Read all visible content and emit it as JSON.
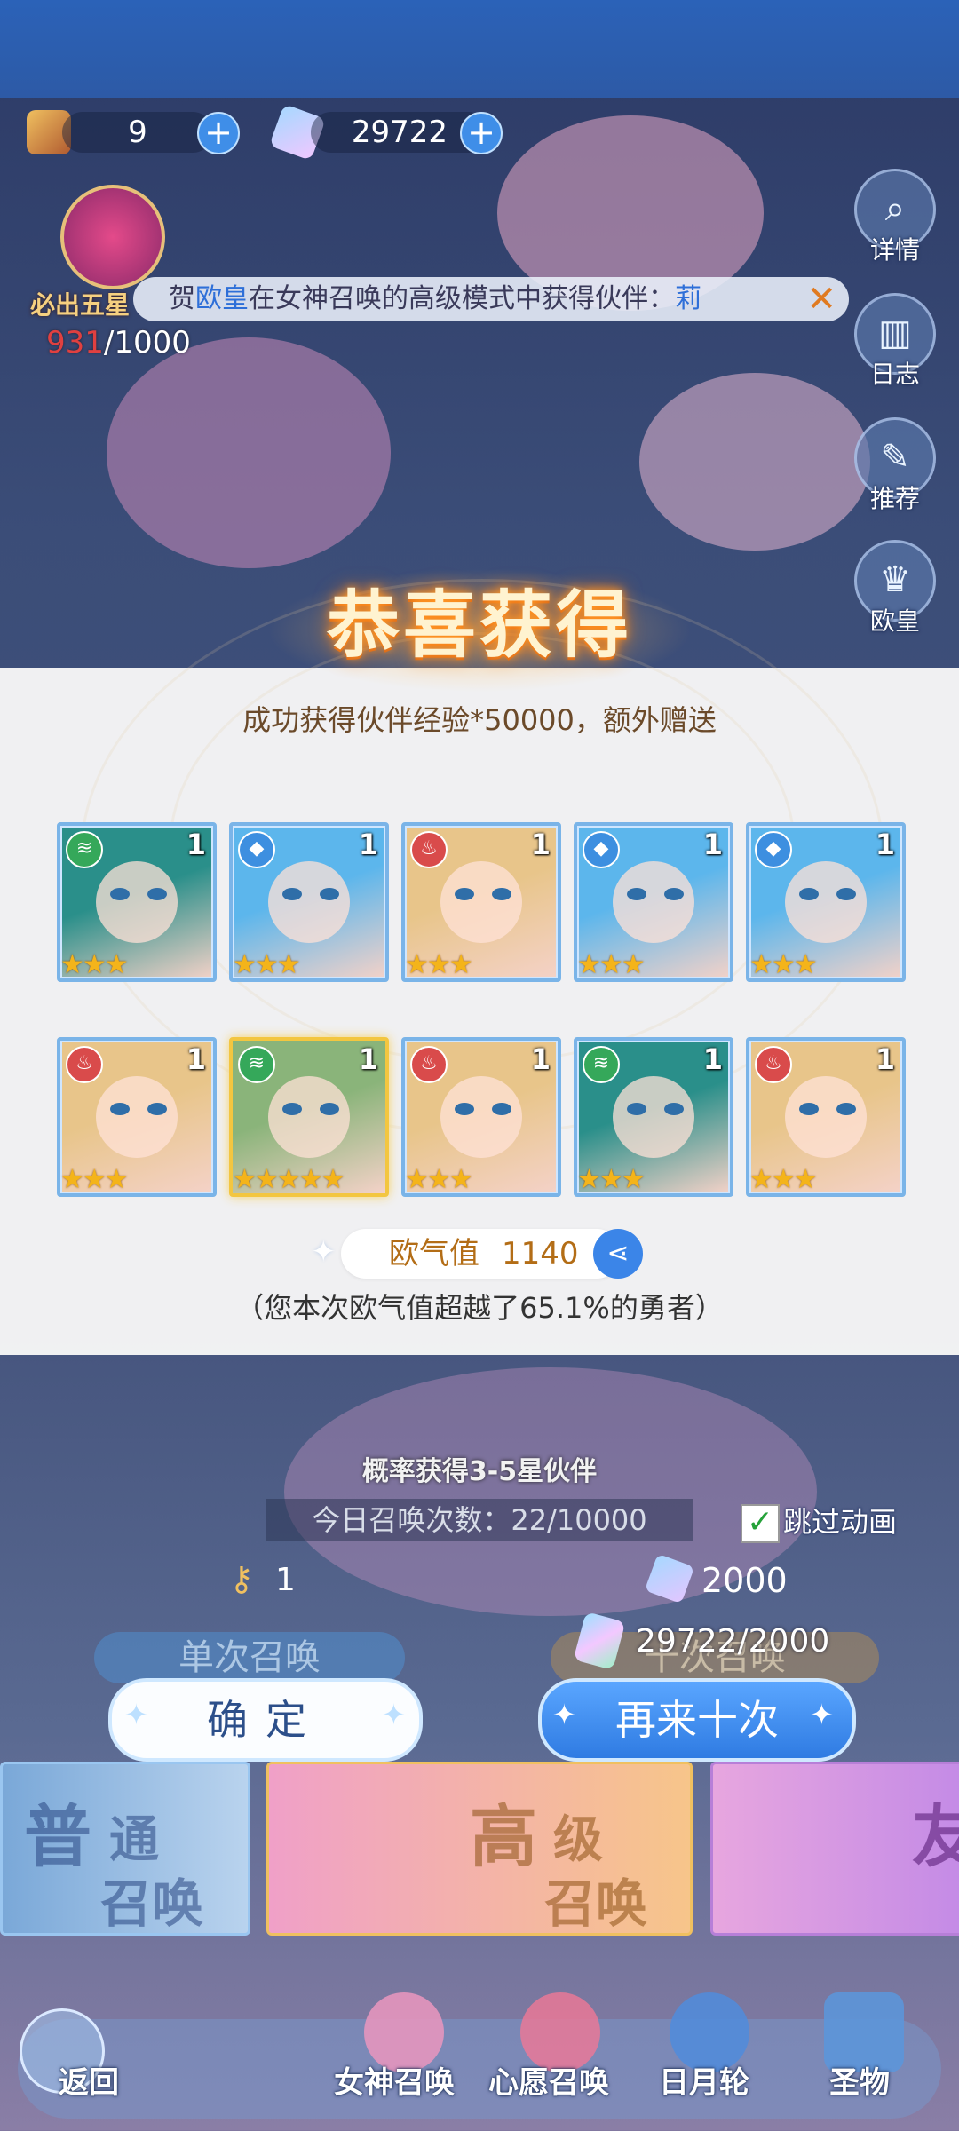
{
  "resources": {
    "keys": "9",
    "gems": "29722"
  },
  "badge": {
    "label": "必出五星",
    "current": "931",
    "total": "/1000"
  },
  "marquee": {
    "prefix": "贺",
    "highlight": "欧皇",
    "text": "在女神召唤的高级模式中获得伙伴：",
    "partner": "莉 "
  },
  "side_buttons": [
    {
      "label": "详情",
      "icon": "magnifier-icon"
    },
    {
      "label": "日志",
      "icon": "book-icon"
    },
    {
      "label": "推荐",
      "icon": "scroll-icon"
    },
    {
      "label": "欧皇",
      "icon": "crown-icon"
    }
  ],
  "result": {
    "title": "恭喜获得",
    "subtitle": "成功获得伙伴经验*50000，额外赠送",
    "cards": [
      {
        "element": "wind",
        "level": "1",
        "stars": "★★★",
        "hair": "#2a8f8a"
      },
      {
        "element": "water",
        "level": "1",
        "stars": "★★★",
        "hair": "#5cb6ec"
      },
      {
        "element": "fire",
        "level": "1",
        "stars": "★★★",
        "hair": "#e8c58a"
      },
      {
        "element": "water",
        "level": "1",
        "stars": "★★★",
        "hair": "#5cb6ec"
      },
      {
        "element": "water",
        "level": "1",
        "stars": "★★★",
        "hair": "#5cb6ec"
      },
      {
        "element": "fire",
        "level": "1",
        "stars": "★★★",
        "hair": "#e8c58a"
      },
      {
        "element": "wind",
        "level": "1",
        "stars": "★★★★★",
        "hair": "#8ab47a"
      },
      {
        "element": "fire",
        "level": "1",
        "stars": "★★★",
        "hair": "#e8c58a"
      },
      {
        "element": "wind",
        "level": "1",
        "stars": "★★★",
        "hair": "#2a8f8a"
      },
      {
        "element": "fire",
        "level": "1",
        "stars": "★★★",
        "hair": "#e8c58a"
      }
    ],
    "ouqi_label": "欧气值",
    "ouqi_value": "1140",
    "ouqi_note": "（您本次欧气值超越了65.1%的勇者）"
  },
  "summon": {
    "probability_text": "概率获得3-5星伙伴",
    "daily_text": "今日召唤次数：22/10000",
    "skip_label": "跳过动画",
    "single_cost": "1",
    "ten_cost": "2000",
    "single_label": "单次召唤",
    "ten_label": "十次召唤",
    "gem_ratio": "29722/2000"
  },
  "buttons": {
    "confirm": "确定",
    "again": "再来十次"
  },
  "modes": [
    {
      "line1": "普",
      "line2": "通",
      "line3": "召唤"
    },
    {
      "line1": "高",
      "line2": "级",
      "line3": "召唤"
    },
    {
      "line1": "友",
      "line2": "",
      "line3": ""
    }
  ],
  "nav": [
    {
      "label": "返回"
    },
    {
      "label": "女神召唤"
    },
    {
      "label": "心愿召唤"
    },
    {
      "label": "日月轮"
    },
    {
      "label": "圣物"
    }
  ],
  "colors": {
    "accent_blue": "#3b85e8",
    "gold": "#f4b41a",
    "title_glow": "#ff9a28",
    "fire": "#d94b4b",
    "water": "#3d8fe0",
    "wind": "#35a85a"
  }
}
